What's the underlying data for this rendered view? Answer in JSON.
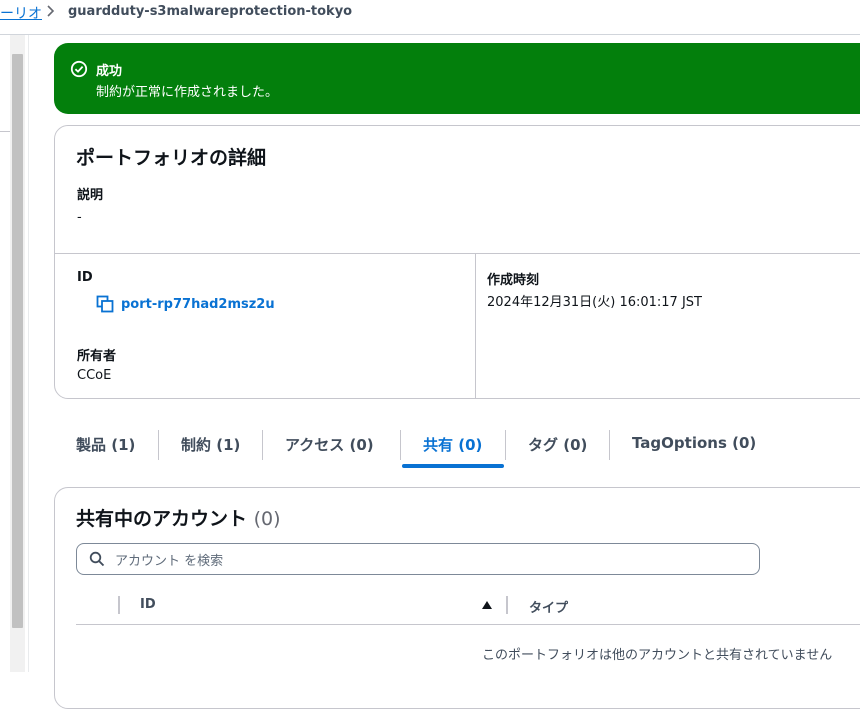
{
  "breadcrumb": {
    "parent_label": "ーリオ",
    "current": "guardduty-s3malwareprotection-tokyo"
  },
  "flash": {
    "title": "成功",
    "message": "制約が正常に作成されました。",
    "color": "#037f0c"
  },
  "details": {
    "title": "ポートフォリオの詳細",
    "description_label": "説明",
    "description_value": "-",
    "id_label": "ID",
    "id_value": "port-rp77had2msz2u",
    "owner_label": "所有者",
    "owner_value": "CCoE",
    "created_label": "作成時刻",
    "created_value": "2024年12月31日(火) 16:01:17 JST"
  },
  "tabs": [
    {
      "label": "製品 (1)",
      "active": false
    },
    {
      "label": "制約 (1)",
      "active": false
    },
    {
      "label": "アクセス (0)",
      "active": false
    },
    {
      "label": "共有 (0)",
      "active": true
    },
    {
      "label": "タグ (0)",
      "active": false
    },
    {
      "label": "TagOptions (0)",
      "active": false
    }
  ],
  "shared": {
    "title": "共有中のアカウント",
    "count": "(0)",
    "search_placeholder": "アカウント を検索",
    "columns": [
      "ID",
      "タイプ"
    ],
    "empty_message": "このポートフォリオは他のアカウントと共有されていません"
  },
  "colors": {
    "link": "#0972d3",
    "success": "#037f0c",
    "border": "#c6c6cd"
  }
}
